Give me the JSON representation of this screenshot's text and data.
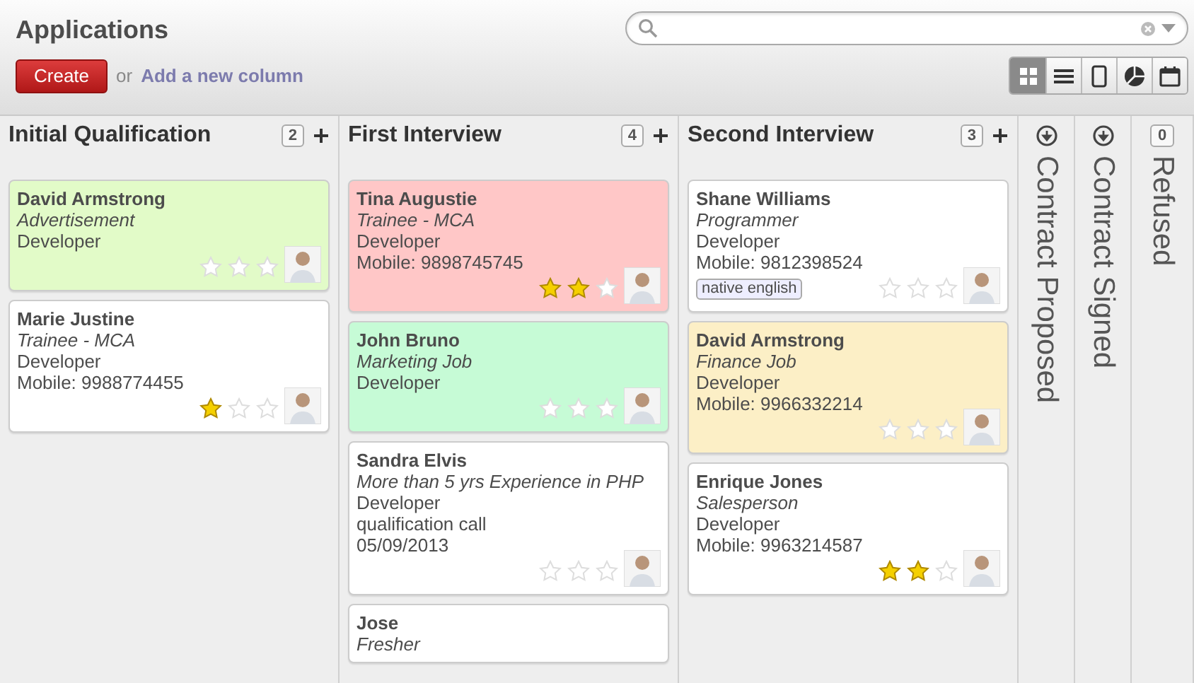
{
  "header": {
    "title": "Applications",
    "create_button": "Create",
    "or_text": "or",
    "add_column_link": "Add a new column",
    "views": [
      {
        "kind": "kanban",
        "selected": true
      },
      {
        "kind": "list",
        "selected": false
      },
      {
        "kind": "form",
        "selected": false
      },
      {
        "kind": "graph",
        "selected": false
      },
      {
        "kind": "calendar",
        "selected": false
      }
    ]
  },
  "columns": [
    {
      "title": "Initial Qualification",
      "count": "2",
      "folded": false,
      "cards": [
        {
          "name": "David Armstrong",
          "source": "Advertisement",
          "lines": [
            "Developer"
          ],
          "stars": 0,
          "color": "#e2fbc8"
        },
        {
          "name": "Marie Justine",
          "source": "Trainee - MCA",
          "lines": [
            "Developer",
            "Mobile: 9988774455"
          ],
          "stars": 1,
          "color": "#ffffff"
        }
      ]
    },
    {
      "title": "First Interview",
      "count": "4",
      "folded": false,
      "cards": [
        {
          "name": "Tina Augustie",
          "source": "Trainee - MCA",
          "lines": [
            "Developer",
            "Mobile: 9898745745"
          ],
          "stars": 2,
          "color": "#ffc7c7"
        },
        {
          "name": "John Bruno",
          "source": "Marketing Job",
          "lines": [
            "Developer"
          ],
          "stars": 0,
          "color": "#c6fbd6"
        },
        {
          "name": "Sandra Elvis",
          "source": "More than 5 yrs Experience in PHP",
          "lines": [
            "Developer",
            "qualification call",
            "05/09/2013"
          ],
          "stars": 0,
          "color": "#ffffff"
        },
        {
          "name": "Jose",
          "source": "Fresher",
          "color": "#ffffff"
        }
      ]
    },
    {
      "title": "Second Interview",
      "count": "3",
      "folded": false,
      "cards": [
        {
          "name": "Shane Williams",
          "source": "Programmer",
          "lines": [
            "Developer",
            "Mobile: 9812398524"
          ],
          "tags": [
            "native english"
          ],
          "stars": 0,
          "color": "#ffffff"
        },
        {
          "name": "David Armstrong",
          "source": "Finance Job",
          "lines": [
            "Developer",
            "Mobile: 9966332214"
          ],
          "stars": 0,
          "color": "#fcefc6"
        },
        {
          "name": "Enrique Jones",
          "source": "Salesperson",
          "lines": [
            "Developer",
            "Mobile: 9963214587"
          ],
          "stars": 2,
          "color": "#ffffff"
        }
      ]
    },
    {
      "title": "Contract Proposed",
      "folded": true
    },
    {
      "title": "Contract Signed",
      "folded": true
    },
    {
      "title": "Refused",
      "count": "0",
      "folded": true
    }
  ]
}
